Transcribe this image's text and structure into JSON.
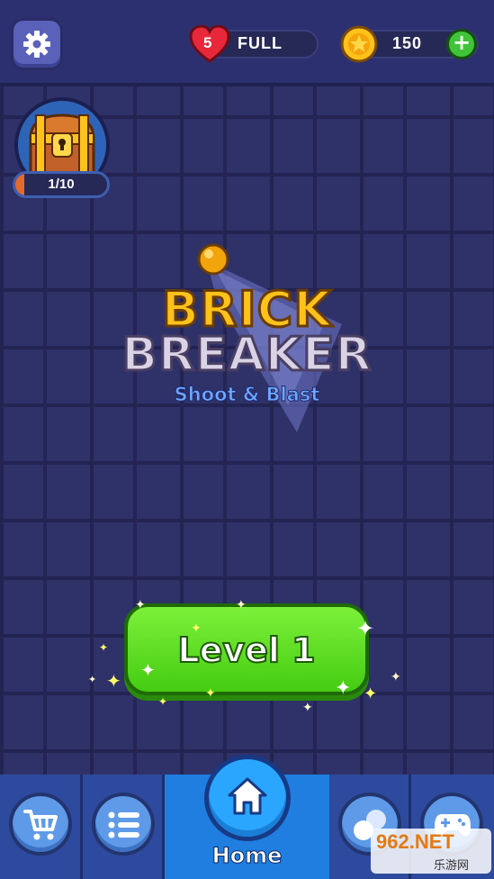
{
  "header": {
    "lives": {
      "count": "5",
      "status": "FULL"
    },
    "coins": {
      "amount": "150",
      "add_symbol": "+"
    }
  },
  "chest": {
    "progress_text": "1/10",
    "progress": 0.1
  },
  "title": {
    "line1": "BRICK",
    "line2": "BREAKER",
    "subtitle": "Shoot & Blast"
  },
  "play": {
    "label": "Level 1"
  },
  "nav": {
    "items": [
      {
        "icon": "cart-icon"
      },
      {
        "icon": "list-icon"
      },
      {
        "icon": "home-icon",
        "label": "Home"
      },
      {
        "icon": "balls-icon"
      },
      {
        "icon": "gamepad-icon"
      }
    ]
  },
  "watermark": {
    "main": "962.NET",
    "sub": "乐游网"
  },
  "colors": {
    "coin": "#ffc21b",
    "heart": "#e8283a",
    "play_button": "#5ad81f",
    "home_active": "#1f7ee0"
  }
}
